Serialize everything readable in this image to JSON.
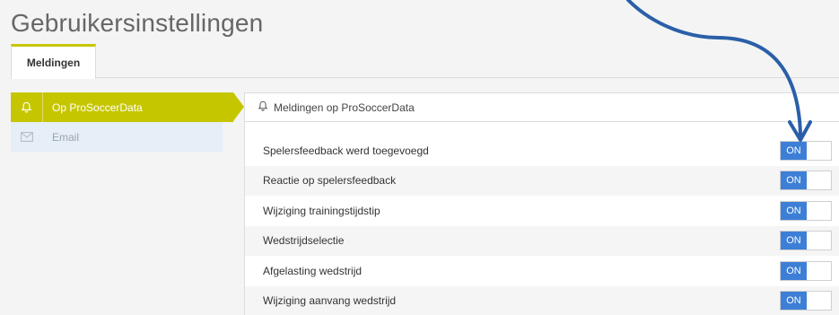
{
  "page": {
    "title": "Gebruikersinstellingen"
  },
  "tabs": [
    {
      "label": "Meldingen",
      "active": true
    }
  ],
  "sidebar": {
    "items": [
      {
        "label": "Op ProSoccerData",
        "icon": "bell-icon",
        "active": true
      },
      {
        "label": "Email",
        "icon": "envelope-icon",
        "active": false
      }
    ]
  },
  "panel": {
    "title": "Meldingen op ProSoccerData",
    "icon": "bell-icon",
    "rows": [
      {
        "label": "Spelersfeedback werd toegevoegd",
        "toggle": "ON"
      },
      {
        "label": "Reactie op spelersfeedback",
        "toggle": "ON"
      },
      {
        "label": "Wijziging trainingstijdstip",
        "toggle": "ON"
      },
      {
        "label": "Wedstrijdselectie",
        "toggle": "ON"
      },
      {
        "label": "Afgelasting wedstrijd",
        "toggle": "ON"
      },
      {
        "label": "Wijziging aanvang wedstrijd",
        "toggle": "ON"
      }
    ]
  },
  "colors": {
    "accent": "#c6c600",
    "toggle_on": "#3d7fd6",
    "annotation_arrow": "#2a5fa8"
  }
}
